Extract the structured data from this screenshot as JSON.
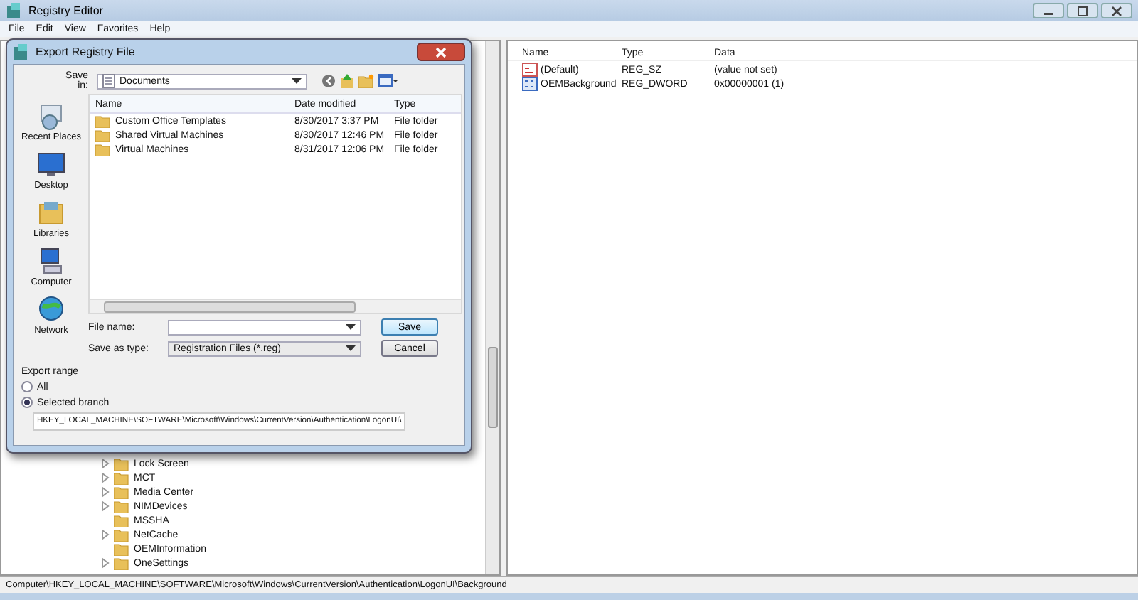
{
  "window": {
    "title": "Registry Editor"
  },
  "menu": [
    "File",
    "Edit",
    "View",
    "Favorites",
    "Help"
  ],
  "tree": [
    {
      "label": "Lock Screen",
      "expandable": true
    },
    {
      "label": "MCT",
      "expandable": true
    },
    {
      "label": "Media Center",
      "expandable": true
    },
    {
      "label": "NIMDevices",
      "expandable": true
    },
    {
      "label": "MSSHA",
      "expandable": false
    },
    {
      "label": "NetCache",
      "expandable": true
    },
    {
      "label": "OEMInformation",
      "expandable": false
    },
    {
      "label": "OneSettings",
      "expandable": true
    }
  ],
  "values": {
    "columns": [
      "Name",
      "Type",
      "Data"
    ],
    "rows": [
      {
        "kind": "string",
        "name": "(Default)",
        "type": "REG_SZ",
        "data": "(value not set)"
      },
      {
        "kind": "binary",
        "name": "OEMBackground",
        "type": "REG_DWORD",
        "data": "0x00000001 (1)"
      }
    ]
  },
  "status_bar": "Computer\\HKEY_LOCAL_MACHINE\\SOFTWARE\\Microsoft\\Windows\\CurrentVersion\\Authentication\\LogonUI\\Background",
  "dialog": {
    "title": "Export Registry File",
    "save_in_label": "Save in:",
    "save_in": "Documents",
    "places": [
      {
        "kind": "recent",
        "label": "Recent Places"
      },
      {
        "kind": "desktop",
        "label": "Desktop"
      },
      {
        "kind": "libraries",
        "label": "Libraries"
      },
      {
        "kind": "computer",
        "label": "Computer"
      },
      {
        "kind": "network",
        "label": "Network"
      }
    ],
    "columns": [
      "Name",
      "Date modified",
      "Type"
    ],
    "files": [
      {
        "name": "Custom Office Templates",
        "date": "8/30/2017 3:37 PM",
        "type": "File folder"
      },
      {
        "name": "Shared Virtual Machines",
        "date": "8/30/2017 12:46 PM",
        "type": "File folder"
      },
      {
        "name": "Virtual Machines",
        "date": "8/31/2017 12:06 PM",
        "type": "File folder"
      }
    ],
    "file_name_label": "File name:",
    "save_type_label": "Save as type:",
    "save_type": "Registration Files (*.reg)",
    "buttons": [
      "Save",
      "Cancel"
    ],
    "export_range": {
      "title": "Export range",
      "options": [
        {
          "label": "All",
          "selected": false
        },
        {
          "label": "Selected branch",
          "selected": true
        }
      ],
      "branch": "HKEY_LOCAL_MACHINE\\SOFTWARE\\Microsoft\\Windows\\CurrentVersion\\Authentication\\LogonUI\\"
    }
  }
}
